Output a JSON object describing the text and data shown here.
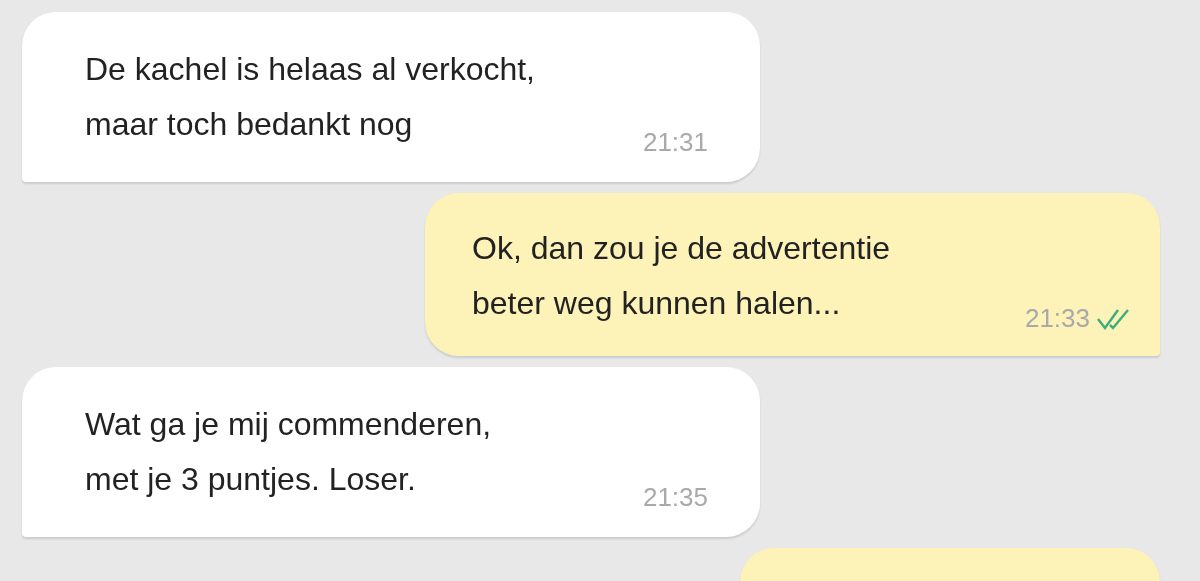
{
  "messages": [
    {
      "kind": "received",
      "text": "De kachel is helaas al verkocht,\nmaar toch bedankt nog",
      "time": "21:31"
    },
    {
      "kind": "sent",
      "text": "Ok, dan zou je de advertentie\nbeter weg kunnen halen...",
      "time": "21:33",
      "read": true
    },
    {
      "kind": "received",
      "text": "Wat ga je mij commenderen,\nmet je 3 puntjes. Loser.",
      "time": "21:35"
    },
    {
      "kind": "sent"
    }
  ]
}
